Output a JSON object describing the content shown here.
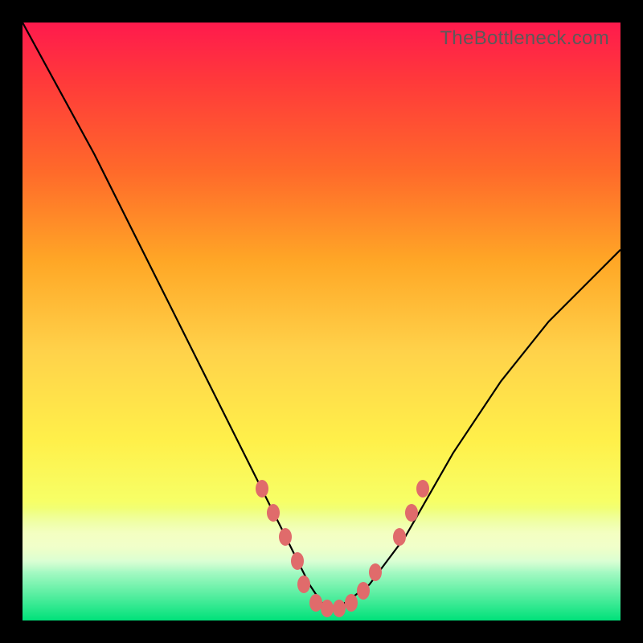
{
  "watermark": "TheBottleneck.com",
  "chart_data": {
    "type": "line",
    "title": "",
    "xlabel": "",
    "ylabel": "",
    "xlim": [
      0,
      100
    ],
    "ylim": [
      0,
      100
    ],
    "grid": false,
    "legend": false,
    "series": [
      {
        "name": "curve",
        "x": [
          0,
          6,
          12,
          18,
          24,
          30,
          36,
          40,
          44,
          46,
          48,
          50,
          52,
          54,
          58,
          64,
          72,
          80,
          88,
          96,
          100
        ],
        "y": [
          100,
          89,
          78,
          66,
          54,
          42,
          30,
          22,
          14,
          10,
          6,
          3,
          2,
          3,
          6,
          14,
          28,
          40,
          50,
          58,
          62
        ]
      }
    ],
    "markers": {
      "name": "highlight-points",
      "color": "#e06b6b",
      "points": [
        {
          "x": 40,
          "y": 22
        },
        {
          "x": 42,
          "y": 18
        },
        {
          "x": 44,
          "y": 14
        },
        {
          "x": 46,
          "y": 10
        },
        {
          "x": 47,
          "y": 6
        },
        {
          "x": 49,
          "y": 3
        },
        {
          "x": 51,
          "y": 2
        },
        {
          "x": 53,
          "y": 2
        },
        {
          "x": 55,
          "y": 3
        },
        {
          "x": 57,
          "y": 5
        },
        {
          "x": 59,
          "y": 8
        },
        {
          "x": 63,
          "y": 14
        },
        {
          "x": 65,
          "y": 18
        },
        {
          "x": 67,
          "y": 22
        }
      ]
    },
    "gradient_stops": [
      {
        "pos": 0,
        "color": "#ff1a4d"
      },
      {
        "pos": 25,
        "color": "#ff6a2a"
      },
      {
        "pos": 55,
        "color": "#ffd24a"
      },
      {
        "pos": 80,
        "color": "#f7ff66"
      },
      {
        "pos": 100,
        "color": "#00e17a"
      }
    ]
  }
}
